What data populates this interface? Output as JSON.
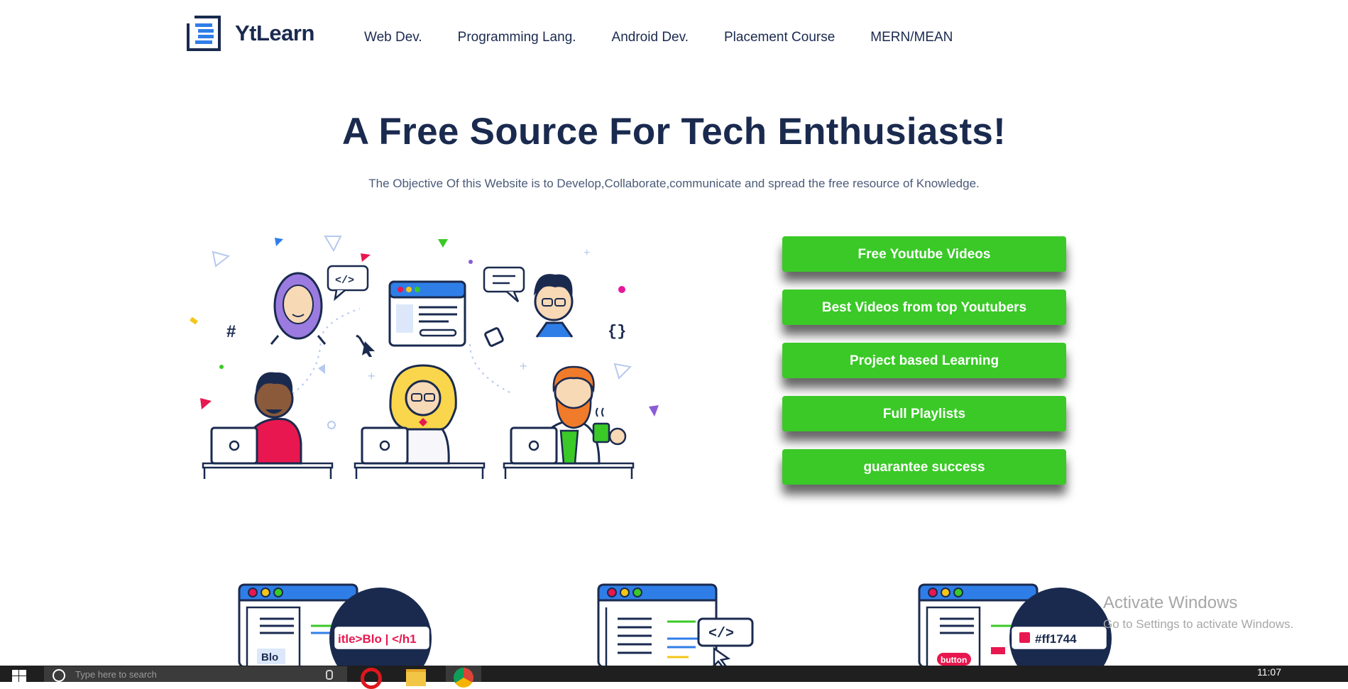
{
  "brand": {
    "name": "YtLearn",
    "color": "#1a2a4f"
  },
  "nav": {
    "items": [
      {
        "label": "Web Dev."
      },
      {
        "label": "Programming Lang."
      },
      {
        "label": "Android Dev."
      },
      {
        "label": "Placement Course"
      },
      {
        "label": "MERN/MEAN"
      }
    ]
  },
  "hero": {
    "title": "A Free Source For Tech Enthusiasts!",
    "subtitle": "The Objective Of this Website is to Develop,Collaborate,communicate and spread the free resource of Knowledge."
  },
  "actions": {
    "accent": "#3ac927",
    "buttons": [
      {
        "label": "Free Youtube Videos"
      },
      {
        "label": "Best Videos from top Youtubers"
      },
      {
        "label": "Project based Learning"
      },
      {
        "label": "Full Playlists"
      },
      {
        "label": "guarantee success"
      }
    ]
  },
  "cards": {
    "left_badge": "itle>Blo | </h1",
    "left_panel": "Blo",
    "middle_badge": "</>",
    "right_badge": "#ff1744",
    "right_button": "button"
  },
  "watermark": {
    "title": "Activate Windows",
    "subtitle": "Go to Settings to activate Windows."
  },
  "taskbar": {
    "search_placeholder": "Type here to search",
    "clock": "11:07"
  },
  "icons": [
    "logo-icon",
    "windows-start-icon",
    "search-icon",
    "microphone-icon",
    "opera-icon",
    "folder-icon",
    "chrome-icon"
  ]
}
